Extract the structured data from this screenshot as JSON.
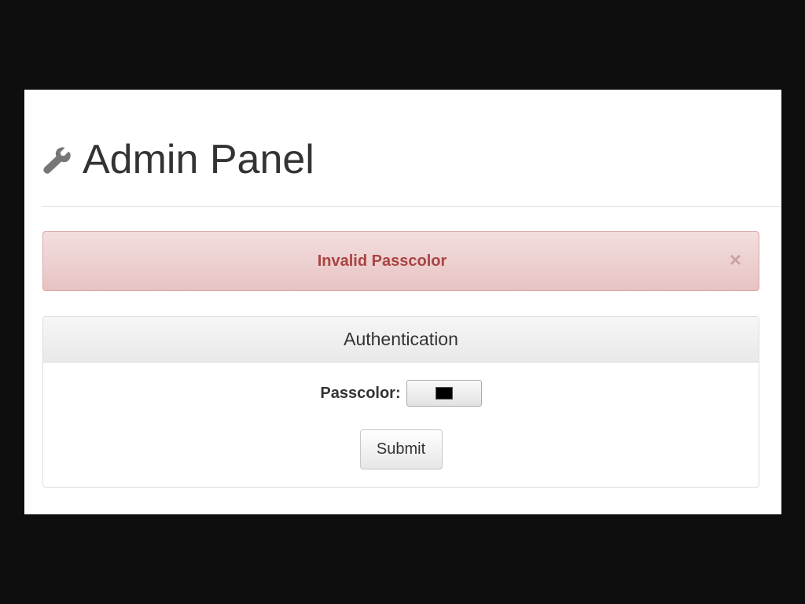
{
  "header": {
    "title": "Admin Panel",
    "icon": "wrench-icon"
  },
  "alert": {
    "message": "Invalid Passcolor",
    "close_glyph": "×",
    "text_color": "#a94442",
    "background_color": "#f2dede"
  },
  "auth_panel": {
    "heading": "Authentication",
    "passcolor_label": "Passcolor:",
    "passcolor_value": "#000000",
    "submit_label": "Submit"
  }
}
